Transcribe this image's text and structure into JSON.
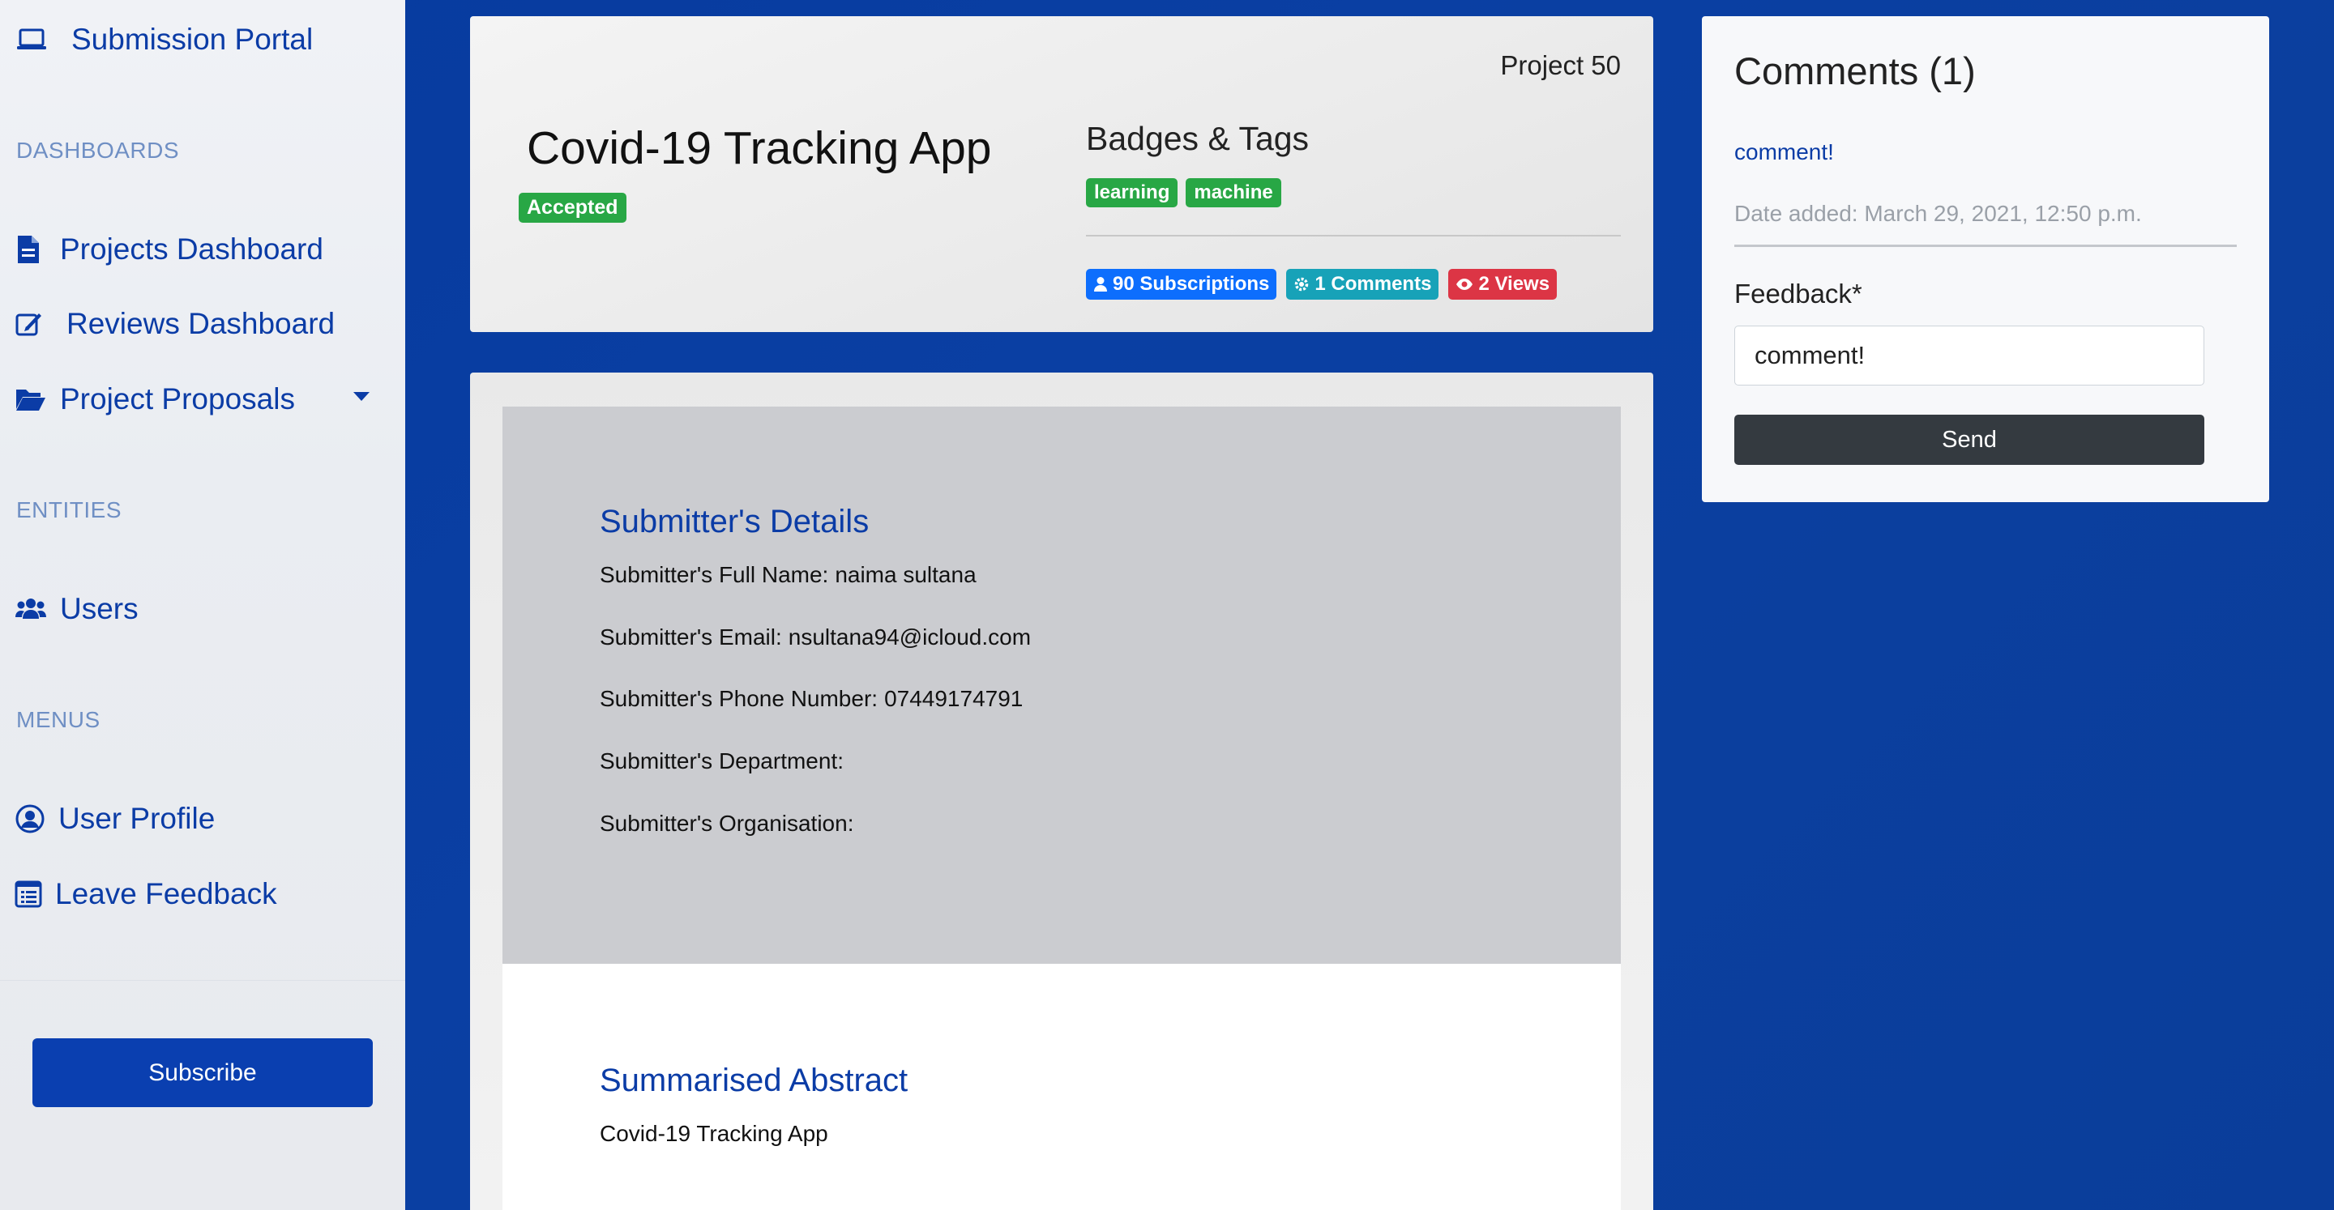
{
  "sidebar": {
    "brand_label": "Submission Portal",
    "sections": {
      "dashboards": "DASHBOARDS",
      "entities": "ENTITIES",
      "menus": "MENUS"
    },
    "items": {
      "projects_dashboard": "Projects Dashboard",
      "reviews_dashboard": "Reviews Dashboard",
      "project_proposals": "Project Proposals",
      "users": "Users",
      "user_profile": "User Profile",
      "leave_feedback": "Leave Feedback"
    },
    "subscribe_label": "Subscribe"
  },
  "header": {
    "project_number": "Project 50",
    "title": "Covid-19 Tracking App",
    "status_badge": "Accepted",
    "badges_title": "Badges & Tags",
    "tags": [
      "learning",
      "machine"
    ],
    "stats": {
      "subscriptions": "90 Subscriptions",
      "comments": "1 Comments",
      "views": "2 Views"
    }
  },
  "submitter": {
    "heading": "Submitter's Details",
    "full_name_label": "Submitter's Full Name:",
    "full_name": "naima sultana",
    "email_label": "Submitter's Email:",
    "email": "nsultana94@icloud.com",
    "phone_label": "Submitter's Phone Number:",
    "phone": "07449174791",
    "department_label": "Submitter's Department:",
    "department": "",
    "organisation_label": "Submitter's Organisation:",
    "organisation": ""
  },
  "abstract": {
    "heading": "Summarised Abstract",
    "text": "Covid-19 Tracking App"
  },
  "comments": {
    "title": "Comments (1)",
    "items": [
      {
        "text": "comment!",
        "date": "Date added: March 29, 2021, 12:50 p.m."
      }
    ],
    "feedback_label": "Feedback*",
    "feedback_value": "comment!",
    "send_label": "Send"
  },
  "colors": {
    "primary": "#0b3ca6",
    "success": "#28a745",
    "info": "#17a2b8",
    "danger": "#dc3545",
    "blue_badge": "#0d6efd",
    "dark_button": "#343a40"
  },
  "icons": {
    "brand": "laptop-icon",
    "projects_dashboard": "file-icon",
    "reviews_dashboard": "edit-icon",
    "project_proposals": "folder-open-icon",
    "users": "users-icon",
    "user_profile": "user-circle-icon",
    "leave_feedback": "list-alt-icon",
    "subscriptions": "user-icon",
    "comments": "cog-icon",
    "views": "eye-icon"
  }
}
